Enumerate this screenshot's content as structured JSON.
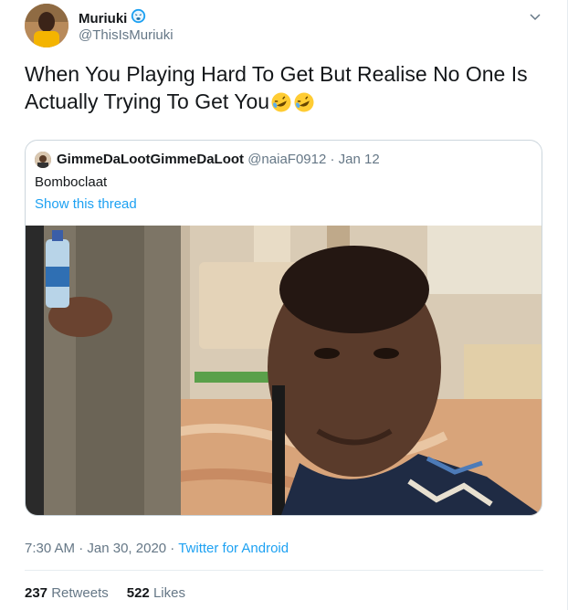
{
  "author": {
    "display_name": "Muriuki",
    "handle": "@ThisIsMuriuki",
    "badge_icon": "weary-face-emoji"
  },
  "tweet": {
    "text": "When You Playing Hard To Get But Realise No One Is Actually Trying To Get You",
    "emojis": [
      "rolling-on-floor-laughing-emoji",
      "rolling-on-floor-laughing-emoji"
    ]
  },
  "quoted_tweet": {
    "display_name": "GimmeDaLootGimmeDaLoot",
    "handle": "@naiaF0912",
    "separator": " · ",
    "date": "Jan 12",
    "text": "Bomboclaat",
    "show_thread_label": "Show this thread",
    "media": "photo-man-looking-at-camera"
  },
  "timestamp": {
    "time": "7:30 AM",
    "separator": " · ",
    "date": "Jan 30, 2020",
    "source": "Twitter for Android"
  },
  "stats": {
    "retweets_count": "237",
    "retweets_label": "Retweets",
    "likes_count": "522",
    "likes_label": "Likes"
  },
  "colors": {
    "link": "#1da1f2",
    "secondary_text": "#657786",
    "border": "#ccd6dd"
  }
}
